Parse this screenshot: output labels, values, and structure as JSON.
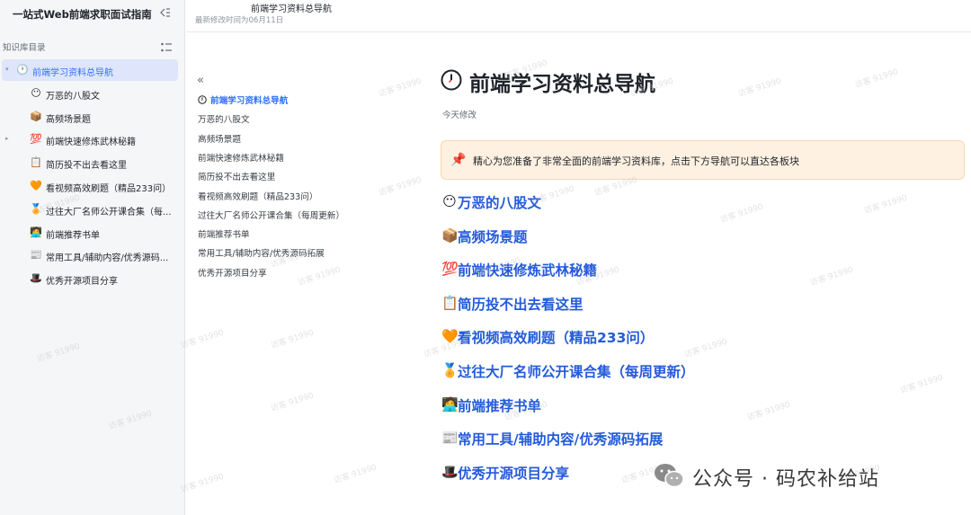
{
  "sidebar": {
    "title": "一站式Web前端求职面试指南",
    "section_label": "知识库目录",
    "items": [
      {
        "icon": "🕐",
        "label": "前端学习资料总导航",
        "active": true,
        "expand": "▾"
      },
      {
        "icon": "😶",
        "label": "万恶的八股文"
      },
      {
        "icon": "📦",
        "label": "高频场景题"
      },
      {
        "icon": "💯",
        "label": "前端快速修炼武林秘籍",
        "expand": "▸"
      },
      {
        "icon": "📋",
        "label": "简历投不出去看这里"
      },
      {
        "icon": "🧡",
        "label": "看视频高效刷题（精品233问）"
      },
      {
        "icon": "🏅",
        "label": "过往大厂名师公开课合集（每..."
      },
      {
        "icon": "🧑‍💻",
        "label": "前端推荐书单"
      },
      {
        "icon": "📰",
        "label": "常用工具/辅助内容/优秀源码..."
      },
      {
        "icon": "🎩",
        "label": "优秀开源项目分享"
      }
    ]
  },
  "header": {
    "title": "前端学习资料总导航",
    "modified": "最新修改时间为06月11日"
  },
  "outline": {
    "collapse_glyph": "«",
    "items": [
      "前端学习资料总导航",
      "万恶的八股文",
      "高频场景题",
      "前端快速修炼武林秘籍",
      "简历投不出去看这里",
      "看视频高效刷题（精品233问）",
      "过往大厂名师公开课合集（每周更新）",
      "前端推荐书单",
      "常用工具/辅助内容/优秀源码拓展",
      "优秀开源项目分享"
    ]
  },
  "doc": {
    "title": "前端学习资料总导航",
    "modified": "今天修改",
    "callout_icon": "📌",
    "callout": "精心为您准备了非常全面的前端学习资料库，点击下方导航可以直达各板块",
    "sections": [
      {
        "icon": "😶",
        "label": "万恶的八股文"
      },
      {
        "icon": "📦",
        "label": "高频场景题"
      },
      {
        "icon": "💯",
        "label": "前端快速修炼武林秘籍"
      },
      {
        "icon": "📋",
        "label": "简历投不出去看这里"
      },
      {
        "icon": "🧡",
        "label": "看视频高效刷题（精品233问）"
      },
      {
        "icon": "🏅",
        "label": "过往大厂名师公开课合集（每周更新）"
      },
      {
        "icon": "🧑‍💻",
        "label": "前端推荐书单"
      },
      {
        "icon": "📰",
        "label": "常用工具/辅助内容/优秀源码拓展"
      },
      {
        "icon": "🎩",
        "label": "优秀开源项目分享"
      }
    ]
  },
  "watermark": "访客 91990",
  "brand": "公众号 · 码农补给站",
  "colors": {
    "accent": "#3370ff",
    "link": "#245bdb",
    "callout_bg": "#fef1e1",
    "sidebar_bg": "#f5f6f7"
  }
}
